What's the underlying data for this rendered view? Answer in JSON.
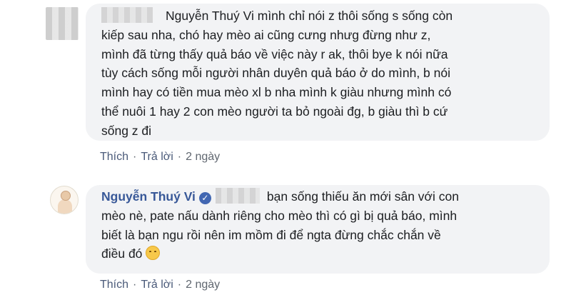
{
  "comment1": {
    "line1": "Nguyễn Thuý Vi mình chỉ nói z thôi sống s sống còn",
    "lines": [
      "kiếp sau nha, chó hay mèo ai cũng cưng nhưg đừng như z,",
      "mình đã từng thấy quả báo về việc này r ak, thôi bye k nói nữa",
      "tùy cách sống mỗi người nhân duyên quả báo ở do mình, b nói",
      "mình hay có tiền mua mèo xl b nha mình k giàu nhưng mình có",
      "thể nuôi 1 hay 2 con mèo người ta bỏ ngoài đg, b giàu thì b cứ",
      "sống z đi"
    ],
    "actions": {
      "like": "Thích",
      "reply": "Trả lời",
      "time": "2 ngày",
      "sep": "·"
    }
  },
  "comment2": {
    "author": "Nguyễn Thuý Vi",
    "verified_glyph": "✓",
    "line1": "bạn sống thiếu ăn mới sân với con",
    "lines": [
      "mèo nè, pate nấu dành riêng cho mèo thì có gì bị quả báo, mình",
      "biết là bạn ngu rồi nên im mồm đi để ngta đừng chắc chắn về"
    ],
    "last_line": "điều đó",
    "emoji": "smiling-face",
    "actions": {
      "like": "Thích",
      "reply": "Trả lời",
      "time": "2 ngày",
      "sep": "·"
    }
  }
}
